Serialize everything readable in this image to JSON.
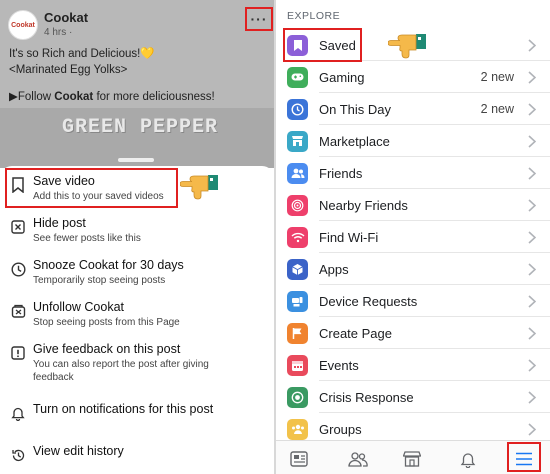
{
  "post": {
    "page_name": "Cookat",
    "time": "4 hrs ·",
    "avatar_text": "Cookat",
    "line1": "It's so Rich and Delicious!💛",
    "line2": "<Marinated Egg Yolks>",
    "cta_prefix": "▶Follow ",
    "cta_bold": "Cookat",
    "cta_suffix": " for more deliciousness!",
    "image_text": "GREEN PEPPER",
    "more_label": "···"
  },
  "sheet": {
    "items": [
      {
        "title": "Save video",
        "subtitle": "Add this to your saved videos",
        "icon": "bookmark-icon"
      },
      {
        "title": "Hide post",
        "subtitle": "See fewer posts like this",
        "icon": "close-square-icon"
      },
      {
        "title": "Snooze Cookat for 30 days",
        "subtitle": "Temporarily stop seeing posts",
        "icon": "clock-icon"
      },
      {
        "title": "Unfollow Cookat",
        "subtitle": "Stop seeing posts from this Page",
        "icon": "unfollow-icon"
      },
      {
        "title": "Give feedback on this post",
        "subtitle": "You can also report the post after giving feedback",
        "icon": "alert-icon"
      },
      {
        "title": "Turn on notifications for this post",
        "subtitle": "",
        "icon": "bell-icon"
      },
      {
        "title": "View edit history",
        "subtitle": "",
        "icon": "history-icon"
      }
    ]
  },
  "explore": {
    "heading": "EXPLORE",
    "items": [
      {
        "label": "Saved",
        "badge": "",
        "icon": "saved-icon",
        "color": "#8c5fd8"
      },
      {
        "label": "Gaming",
        "badge": "2 new",
        "icon": "gaming-icon",
        "color": "#3fae5b"
      },
      {
        "label": "On This Day",
        "badge": "2 new",
        "icon": "on-this-day-icon",
        "color": "#3b74d8"
      },
      {
        "label": "Marketplace",
        "badge": "",
        "icon": "marketplace-icon",
        "color": "#3aa8c7"
      },
      {
        "label": "Friends",
        "badge": "",
        "icon": "friends-icon",
        "color": "#4b8cf0"
      },
      {
        "label": "Nearby Friends",
        "badge": "",
        "icon": "nearby-friends-icon",
        "color": "#ee3f6b"
      },
      {
        "label": "Find Wi-Fi",
        "badge": "",
        "icon": "wifi-icon",
        "color": "#ee3f6b"
      },
      {
        "label": "Apps",
        "badge": "",
        "icon": "apps-icon",
        "color": "#3b63c8"
      },
      {
        "label": "Device Requests",
        "badge": "",
        "icon": "device-requests-icon",
        "color": "#3b90e0"
      },
      {
        "label": "Create Page",
        "badge": "",
        "icon": "create-page-icon",
        "color": "#f0832f"
      },
      {
        "label": "Events",
        "badge": "",
        "icon": "events-icon",
        "color": "#e94a5c"
      },
      {
        "label": "Crisis Response",
        "badge": "",
        "icon": "crisis-response-icon",
        "color": "#3a9a62"
      },
      {
        "label": "Groups",
        "badge": "",
        "icon": "groups-icon",
        "color": "#f2c24a"
      }
    ]
  },
  "tabbar": {
    "tabs": [
      "news-feed-icon",
      "friends-tab-icon",
      "marketplace-tab-icon",
      "notifications-icon",
      "menu-icon"
    ]
  },
  "colors": {
    "highlight": "#e02020",
    "hand": "#f5b94a",
    "cuff": "#1f8a74"
  }
}
